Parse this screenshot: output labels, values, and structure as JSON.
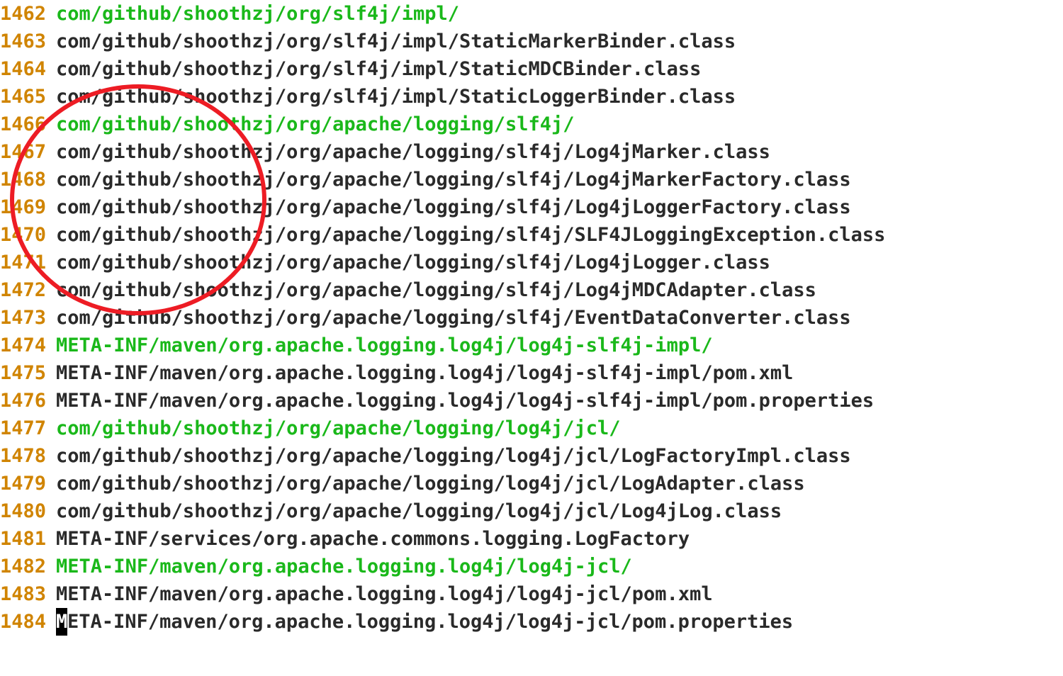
{
  "lines": [
    {
      "num": "1462",
      "text": "com/github/shoothzj/org/slf4j/impl/",
      "type": "dir"
    },
    {
      "num": "1463",
      "text": "com/github/shoothzj/org/slf4j/impl/StaticMarkerBinder.class",
      "type": "file"
    },
    {
      "num": "1464",
      "text": "com/github/shoothzj/org/slf4j/impl/StaticMDCBinder.class",
      "type": "file"
    },
    {
      "num": "1465",
      "text": "com/github/shoothzj/org/slf4j/impl/StaticLoggerBinder.class",
      "type": "file"
    },
    {
      "num": "1466",
      "text": "com/github/shoothzj/org/apache/logging/slf4j/",
      "type": "dir"
    },
    {
      "num": "1467",
      "text": "com/github/shoothzj/org/apache/logging/slf4j/Log4jMarker.class",
      "type": "file"
    },
    {
      "num": "1468",
      "text": "com/github/shoothzj/org/apache/logging/slf4j/Log4jMarkerFactory.class",
      "type": "file"
    },
    {
      "num": "1469",
      "text": "com/github/shoothzj/org/apache/logging/slf4j/Log4jLoggerFactory.class",
      "type": "file"
    },
    {
      "num": "1470",
      "text": "com/github/shoothzj/org/apache/logging/slf4j/SLF4JLoggingException.class",
      "type": "file"
    },
    {
      "num": "1471",
      "text": "com/github/shoothzj/org/apache/logging/slf4j/Log4jLogger.class",
      "type": "file"
    },
    {
      "num": "1472",
      "text": "com/github/shoothzj/org/apache/logging/slf4j/Log4jMDCAdapter.class",
      "type": "file"
    },
    {
      "num": "1473",
      "text": "com/github/shoothzj/org/apache/logging/slf4j/EventDataConverter.class",
      "type": "file"
    },
    {
      "num": "1474",
      "text": "META-INF/maven/org.apache.logging.log4j/log4j-slf4j-impl/",
      "type": "dir"
    },
    {
      "num": "1475",
      "text": "META-INF/maven/org.apache.logging.log4j/log4j-slf4j-impl/pom.xml",
      "type": "file"
    },
    {
      "num": "1476",
      "text": "META-INF/maven/org.apache.logging.log4j/log4j-slf4j-impl/pom.properties",
      "type": "file"
    },
    {
      "num": "1477",
      "text": "com/github/shoothzj/org/apache/logging/log4j/jcl/",
      "type": "dir"
    },
    {
      "num": "1478",
      "text": "com/github/shoothzj/org/apache/logging/log4j/jcl/LogFactoryImpl.class",
      "type": "file"
    },
    {
      "num": "1479",
      "text": "com/github/shoothzj/org/apache/logging/log4j/jcl/LogAdapter.class",
      "type": "file"
    },
    {
      "num": "1480",
      "text": "com/github/shoothzj/org/apache/logging/log4j/jcl/Log4jLog.class",
      "type": "file"
    },
    {
      "num": "1481",
      "text": "META-INF/services/org.apache.commons.logging.LogFactory",
      "type": "file"
    },
    {
      "num": "1482",
      "text": "META-INF/maven/org.apache.logging.log4j/log4j-jcl/",
      "type": "dir"
    },
    {
      "num": "1483",
      "text": "META-INF/maven/org.apache.logging.log4j/log4j-jcl/pom.xml",
      "type": "file"
    },
    {
      "num": "1484",
      "text": "META-INF/maven/org.apache.logging.log4j/log4j-jcl/pom.properties",
      "type": "file",
      "cursor": true
    }
  ],
  "annotation": {
    "color": "#ed1c24",
    "stroke_width": 6
  }
}
